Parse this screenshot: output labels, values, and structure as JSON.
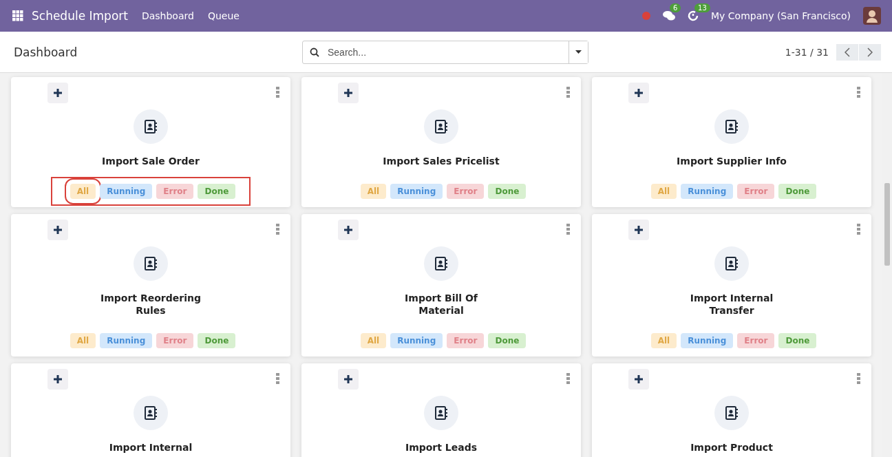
{
  "navbar": {
    "app_title": "Schedule Import",
    "menu": [
      "Dashboard",
      "Queue"
    ],
    "chat_count": "6",
    "activity_count": "13",
    "company": "My Company (San Francisco)"
  },
  "control_panel": {
    "breadcrumb": "Dashboard",
    "search": {
      "placeholder": "Search..."
    },
    "pager": "1-31 / 31"
  },
  "cards": [
    {
      "title_lines": [
        "Import Sale Order"
      ],
      "highlighted": true,
      "filters": [
        {
          "label": "All",
          "kind": "all",
          "highlighted": true
        },
        {
          "label": "Running",
          "kind": "running",
          "highlighted": false
        },
        {
          "label": "Error",
          "kind": "error",
          "highlighted": false
        },
        {
          "label": "Done",
          "kind": "done",
          "highlighted": false
        }
      ]
    },
    {
      "title_lines": [
        "Import Sales Pricelist"
      ],
      "highlighted": false,
      "filters": [
        {
          "label": "All",
          "kind": "all",
          "highlighted": false
        },
        {
          "label": "Running",
          "kind": "running",
          "highlighted": false
        },
        {
          "label": "Error",
          "kind": "error",
          "highlighted": false
        },
        {
          "label": "Done",
          "kind": "done",
          "highlighted": false
        }
      ]
    },
    {
      "title_lines": [
        "Import Supplier Info"
      ],
      "highlighted": false,
      "filters": [
        {
          "label": "All",
          "kind": "all",
          "highlighted": false
        },
        {
          "label": "Running",
          "kind": "running",
          "highlighted": false
        },
        {
          "label": "Error",
          "kind": "error",
          "highlighted": false
        },
        {
          "label": "Done",
          "kind": "done",
          "highlighted": false
        }
      ]
    },
    {
      "title_lines": [
        "Import Reordering",
        "Rules"
      ],
      "highlighted": false,
      "filters": [
        {
          "label": "All",
          "kind": "all",
          "highlighted": false
        },
        {
          "label": "Running",
          "kind": "running",
          "highlighted": false
        },
        {
          "label": "Error",
          "kind": "error",
          "highlighted": false
        },
        {
          "label": "Done",
          "kind": "done",
          "highlighted": false
        }
      ]
    },
    {
      "title_lines": [
        "Import Bill Of",
        "Material"
      ],
      "highlighted": false,
      "filters": [
        {
          "label": "All",
          "kind": "all",
          "highlighted": false
        },
        {
          "label": "Running",
          "kind": "running",
          "highlighted": false
        },
        {
          "label": "Error",
          "kind": "error",
          "highlighted": false
        },
        {
          "label": "Done",
          "kind": "done",
          "highlighted": false
        }
      ]
    },
    {
      "title_lines": [
        "Import Internal",
        "Transfer"
      ],
      "highlighted": false,
      "filters": [
        {
          "label": "All",
          "kind": "all",
          "highlighted": false
        },
        {
          "label": "Running",
          "kind": "running",
          "highlighted": false
        },
        {
          "label": "Error",
          "kind": "error",
          "highlighted": false
        },
        {
          "label": "Done",
          "kind": "done",
          "highlighted": false
        }
      ]
    },
    {
      "title_lines": [
        "Import Internal"
      ]
    },
    {
      "title_lines": [
        "Import Leads"
      ]
    },
    {
      "title_lines": [
        "Import Product"
      ]
    }
  ]
}
